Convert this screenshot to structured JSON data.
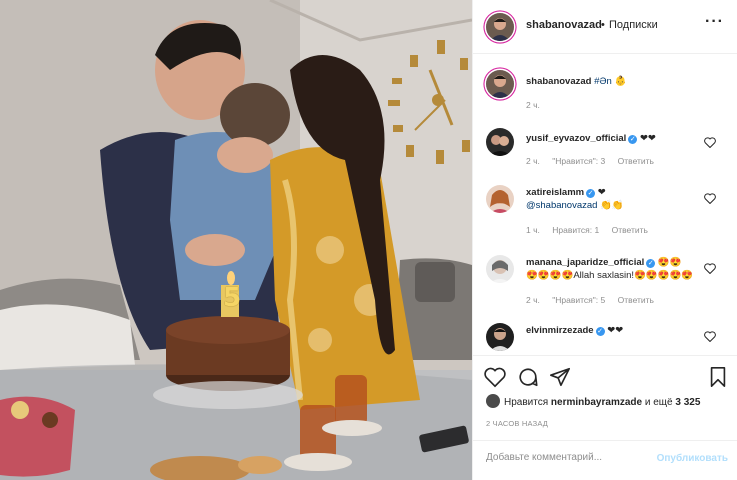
{
  "post": {
    "author": "shabanovazad",
    "follow_sep": "•",
    "follow_label": "Подписки",
    "more_icon": "more-icon",
    "caption_user": "shabanovazad",
    "caption_text": "#Ən 👶",
    "caption_time": "2 ч.",
    "likes_prefix": "Нравится",
    "likes_user": "nerminbayramzade",
    "likes_suffix": "и ещё",
    "likes_count": "3 325",
    "time_ago": "2 ЧАСОВ НАЗАД",
    "add_comment_placeholder": "Добавьте комментарий...",
    "publish_label": "Опубликовать"
  },
  "photo": {
    "candle_number": "5"
  },
  "comments": [
    {
      "user": "yusif_eyvazov_official",
      "verified": true,
      "text": "❤❤",
      "line2": "",
      "time": "2 ч.",
      "likes": "\"Нравится\": 3",
      "reply": "Ответить"
    },
    {
      "user": "xatireislamm",
      "verified": true,
      "text": "❤",
      "line2_mention": "@shabanovazad",
      "line2": "👏👏",
      "time": "1 ч.",
      "likes": "Нравится: 1",
      "reply": "Ответить"
    },
    {
      "user": "manana_japaridze_official",
      "verified": true,
      "text": "😍😍",
      "line2": "😍😍😍😍Allah saxlasin!😍😍😍😍😍",
      "time": "2 ч.",
      "likes": "\"Нравится\": 5",
      "reply": "Ответить"
    },
    {
      "user": "elvinmirzezade",
      "verified": true,
      "text": "❤❤",
      "line2": "",
      "time": "",
      "likes": "",
      "reply": ""
    }
  ],
  "colors": {
    "verified": "#3897f0",
    "link": "#00376b",
    "muted": "#8e8e8e",
    "publish_disabled": "#b2dffc"
  }
}
